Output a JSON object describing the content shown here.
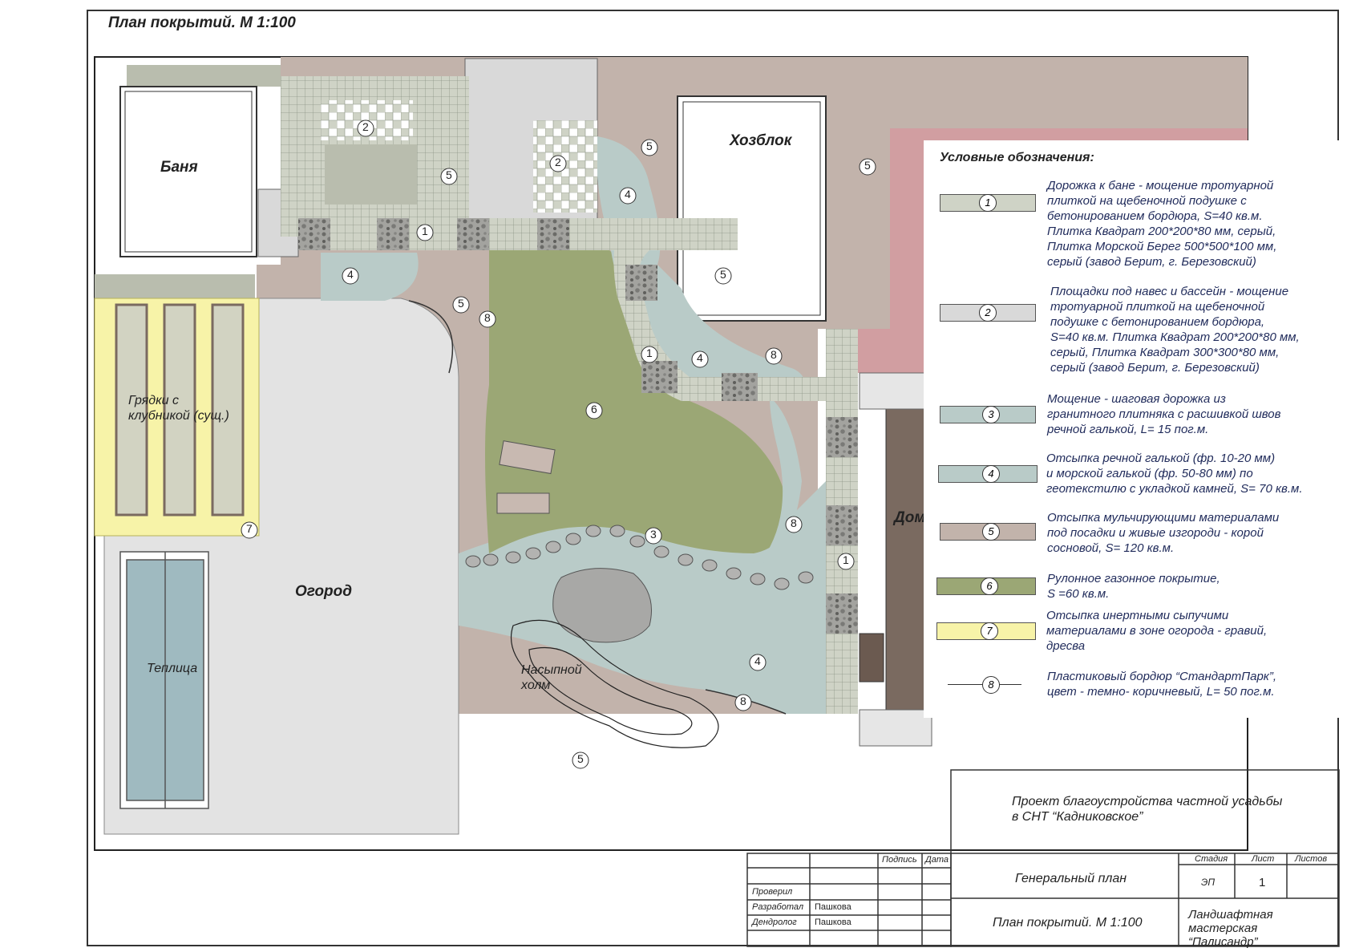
{
  "sheet": {
    "title": "План покрытий. М 1:100"
  },
  "plan_labels": {
    "banya": "Баня",
    "hozblok": "Хозблок",
    "dom": "Дом",
    "ogorod": "Огород",
    "teplica": "Теплица",
    "gryadki": "Грядки с клубникой (сущ.)",
    "holm": "Насыпной холм"
  },
  "markers": {
    "m1": "1",
    "m2": "2",
    "m3": "3",
    "m4": "4",
    "m5": "5",
    "m6": "6",
    "m7": "7",
    "m8": "8"
  },
  "legend": {
    "title": "Условные обозначения:",
    "items": [
      {
        "num": "1",
        "text": "Дорожка к бане - мощение тротуарной\nплиткой на щебеночной подушке с\nбетонированием бордюра, S=40 кв.м.\nПлитка Квадрат 200*200*80 мм, серый,\nПлитка Морской Берег 500*500*100 мм,\nсерый (завод Берит, г. Березовский)"
      },
      {
        "num": "2",
        "text": "Площадки под навес и бассейн - мощение\nтротуарной плиткой на щебеночной\nподушке с бетонированием бордюра,\nS=40 кв.м. Плитка Квадрат 200*200*80 мм,\nсерый, Плитка Квадрат 300*300*80 мм,\nсерый (завод Берит, г. Березовский)"
      },
      {
        "num": "3",
        "text": "Мощение - шаговая дорожка из\nгранитного плитняка с расшивкой швов\nречной галькой, L= 15 пог.м."
      },
      {
        "num": "4",
        "text": "Отсыпка речной галькой (фр. 10-20 мм)\nи морской галькой (фр. 50-80 мм) по\nгеотекстилю с укладкой камней, S= 70 кв.м."
      },
      {
        "num": "5",
        "text": "Отсыпка мульчирующими материалами\nпод посадки и живые изгороди - корой\nсосновой, S= 120 кв.м."
      },
      {
        "num": "6",
        "text": "Рулонное газонное покрытие,\nS =60 кв.м."
      },
      {
        "num": "7",
        "text": "Отсыпка инертными сыпучими\nматериалами в зоне огорода - гравий,\nдресва"
      },
      {
        "num": "8",
        "text": "Пластиковый бордюр “СтандартПарк”,\nцвет - темно- коричневый, L= 50 пог.м."
      }
    ],
    "colors": {
      "c1": "#cfd3c6",
      "c2": "#d9d9d9",
      "c3": "#b9cbc8",
      "c4": "#b9cbc8",
      "c5": "#c2b3ab",
      "c6": "#9ba775",
      "c7": "#f7f3a8"
    }
  },
  "title_block": {
    "project": "Проект благоустройства частной усадьбы\nв СНТ “Кадниковское”",
    "podpis": "Подпись",
    "data": "Дата",
    "stadiya": "Стадия",
    "list": "Лист",
    "listov": "Листов",
    "genplan": "Генеральный план",
    "stage_value": "ЭП",
    "sheet_value": "1",
    "proveril": "Проверил",
    "razrabotal": "Разработал",
    "dendrolog": "Дендролог",
    "razrabotal_name": "Пашкова",
    "dendrolog_name": "Пашкова",
    "plan_title": "План покрытий. М 1:100",
    "studio": "Ландшафтная мастерская\n“Палисандр”"
  },
  "palette": {
    "mulch": "#c2b3ab",
    "lawn": "#9ba775",
    "gravel": "#b9cbc8",
    "paving": "#cfd3c6",
    "concrete": "#d9d9d9",
    "yellow": "#f7f3a8",
    "pink": "#d19ea1",
    "house": "#7a6a60",
    "garden": "#e3e3e3"
  }
}
